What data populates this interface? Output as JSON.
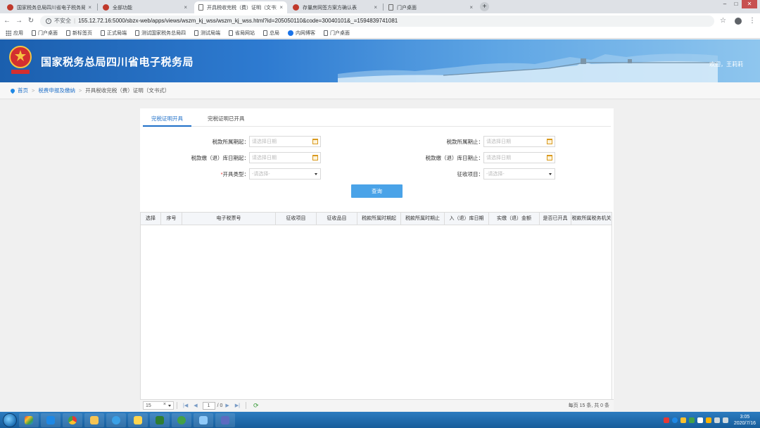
{
  "browser": {
    "tabs": [
      {
        "label": "国家税务总局四川省电子税务局",
        "icon": "emblem-icon"
      },
      {
        "label": "全部功能",
        "icon": "emblem-icon"
      },
      {
        "label": "开具税收完税（费）证明（文书式）",
        "icon": "document-icon"
      },
      {
        "label": "存量房网签方案方确认表",
        "icon": "emblem-icon"
      },
      {
        "label": "门户桌面",
        "icon": "document-icon"
      }
    ],
    "close_glyph": "×",
    "new_tab_glyph": "+",
    "security_label": "不安全",
    "url": "155.12.72.16:5000/sbzx-web/apps/views/wszm_kj_wss/wszm_kj_wss.html?id=205050110&code=30040101&_=1594839741081",
    "bookmarks": [
      "应用",
      "门户桌面",
      "新标签页",
      "正式局端",
      "测试国家税务总局四",
      "测试局端",
      "省局网站",
      "总局",
      "内网博客",
      "门户桌面"
    ]
  },
  "site": {
    "title": "国家税务总局四川省电子税务局",
    "welcome": "欢迎，王莉莉"
  },
  "breadcrumb": {
    "home": "首页",
    "level1": "税费申报及缴纳",
    "current": "开具税收完税（费）证明（文书式）",
    "separator": ">"
  },
  "form": {
    "tabs": [
      "完税证明开具",
      "完税证明已开具"
    ],
    "fields": {
      "period_start_label": "税款所属期起：",
      "period_end_label": "税款所属期止：",
      "store_start_label": "税款缴（退）库日期起：",
      "store_end_label": "税款缴（退）库日期止：",
      "type_required": "*",
      "type_label": "开具类型：",
      "collect_label": "征收项目：",
      "date_placeholder": "请选择日期",
      "select_placeholder": "-请选择-"
    },
    "query_button": "查询"
  },
  "grid": {
    "columns": [
      "选择",
      "序号",
      "电子税票号",
      "征收项目",
      "征收品目",
      "税款所属时期起",
      "税款所属时期止",
      "入（退）库日期",
      "实缴（退）金额",
      "是否已开具",
      "税款所属税务机关"
    ],
    "rows": []
  },
  "pager": {
    "page_size": "15",
    "clear_glyph": "×",
    "current_page": "1",
    "total_pages_text": "/ 0",
    "summary": "每页 15 条, 共 0 条"
  },
  "taskbar": {
    "time": "3:05",
    "date": "2020/7/16"
  }
}
